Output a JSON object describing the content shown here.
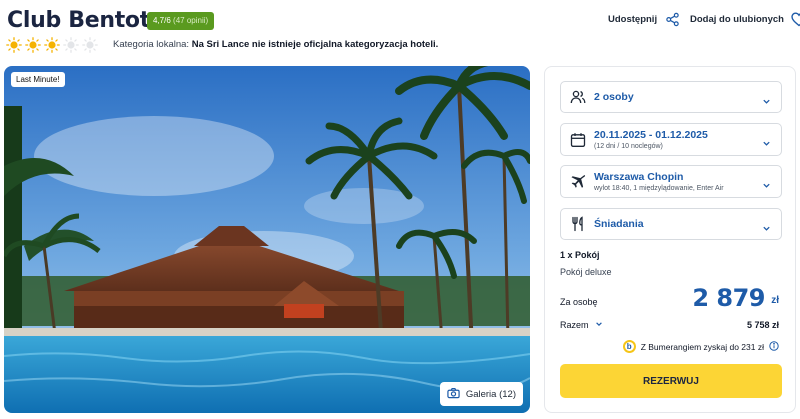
{
  "hotel": {
    "name": "Club Bentota",
    "rating": "4,7/6",
    "reviews": "(47 opinii)",
    "stars_total": 5,
    "stars_filled": 3,
    "category_label": "Kategoria lokalna:",
    "category_note": "Na Sri Lance nie istnieje oficjalna kategoryzacja hoteli."
  },
  "actions": {
    "share_label": "Udostępnij",
    "favorite_label": "Dodaj do ulubionych"
  },
  "gallery": {
    "badge": "Last Minute!",
    "button_label": "Galeria (12)"
  },
  "booking": {
    "guests": "2 osoby",
    "dates": "20.11.2025 - 01.12.2025",
    "dates_sub": "(12 dni / 10 noclegów)",
    "departure": "Warszawa Chopin",
    "departure_sub": "wylot 18:40, 1 międzylądowanie, Enter Air",
    "board": "Śniadania",
    "room_count": "1 x Pokój",
    "room_type": "Pokój deluxe",
    "per_person_label": "Za osobę",
    "price": "2 879",
    "currency": "zł",
    "total_label": "Razem",
    "total_value": "5 758 zł",
    "bumerang_text": "Z Bumerangiem zyskaj do 231 zł",
    "reserve_label": "REZERWUJ"
  },
  "colors": {
    "accent": "#1e5ba8",
    "rating_badge": "#5a9a1f",
    "reserve": "#fcd535",
    "sun": "#f5b301"
  }
}
